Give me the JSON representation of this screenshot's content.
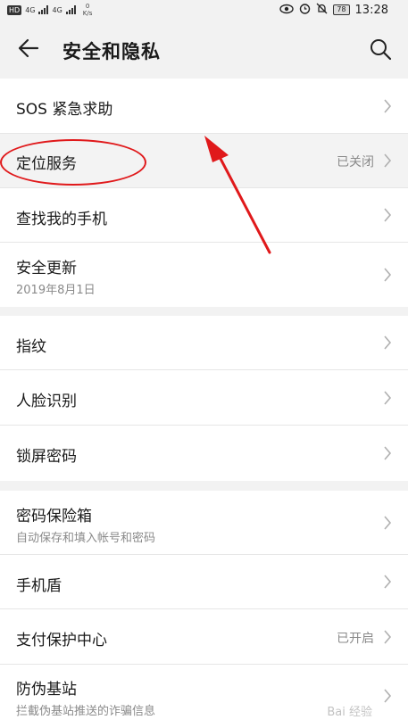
{
  "statusbar": {
    "hd_badge": "HD",
    "network_1": "4G",
    "network_2": "4G",
    "speed_value": "0",
    "speed_unit": "K/s",
    "battery": "78",
    "time": "13:28"
  },
  "header": {
    "title": "安全和隐私",
    "back_icon": "arrow-left-icon",
    "search_icon": "search-icon"
  },
  "groups": [
    {
      "items": [
        {
          "label": "SOS 紧急求助"
        },
        {
          "label": "定位服务",
          "value": "已关闭"
        },
        {
          "label": "查找我的手机"
        },
        {
          "label": "安全更新",
          "sub": "2019年8月1日"
        }
      ]
    },
    {
      "items": [
        {
          "label": "指纹"
        },
        {
          "label": "人脸识别"
        },
        {
          "label": "锁屏密码"
        }
      ]
    },
    {
      "items": [
        {
          "label": "密码保险箱",
          "sub": "自动保存和填入帐号和密码"
        },
        {
          "label": "手机盾"
        },
        {
          "label": "支付保护中心",
          "value": "已开启"
        },
        {
          "label": "防伪基站",
          "sub": "拦截伪基站推送的诈骗信息"
        }
      ]
    }
  ],
  "annotation": {
    "color": "#e0191b"
  },
  "watermark": "Bai 经验"
}
